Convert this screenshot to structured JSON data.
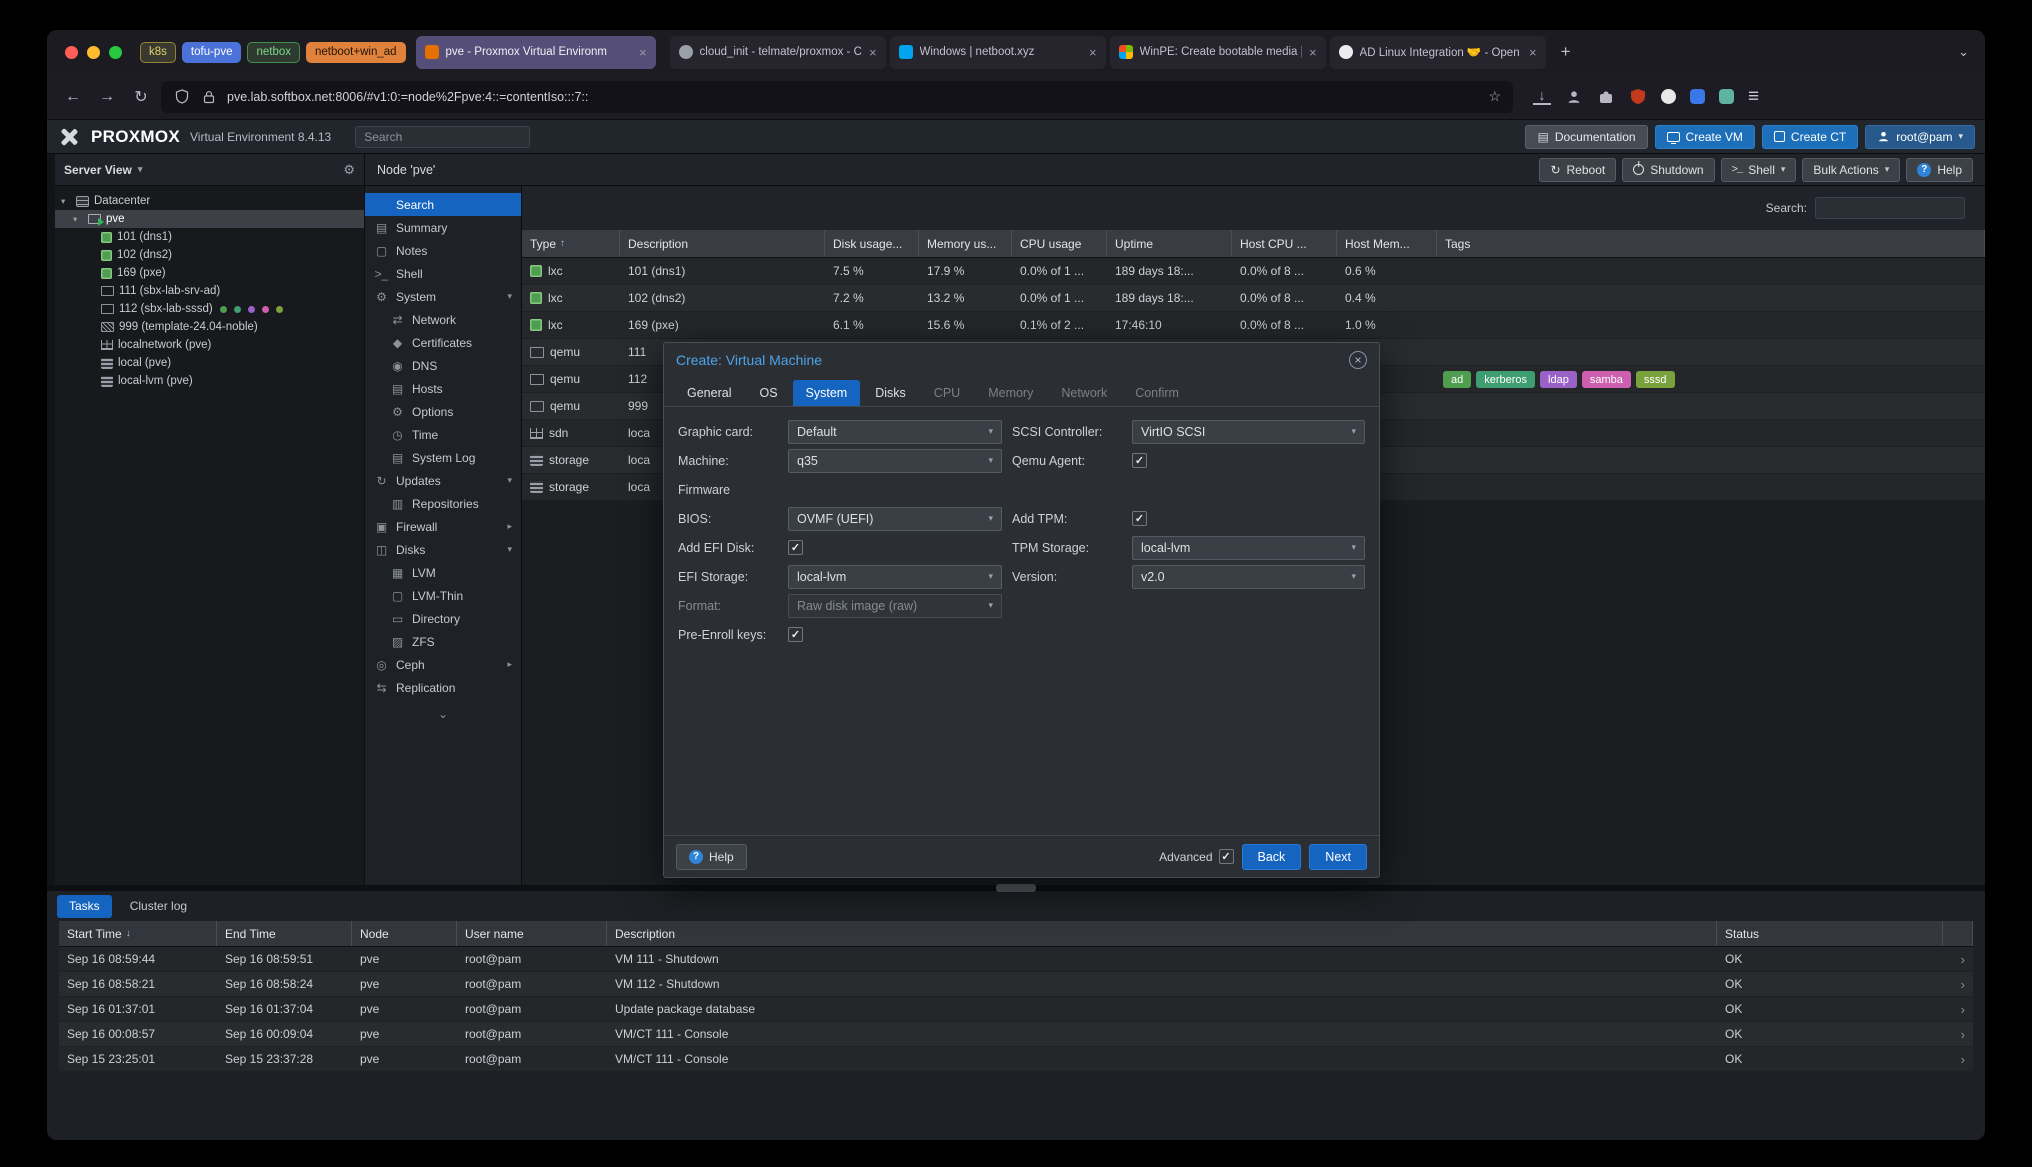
{
  "browser": {
    "tab_groups": [
      {
        "label": "k8s",
        "style": "color:#e0d36a;box-shadow:inset 0 0 0 1px #8f8435;background:#3a3930"
      },
      {
        "label": "tofu-pve",
        "style": "background:#4a72d8;color:#ffffff"
      },
      {
        "label": "netbox",
        "style": "color:#7fd88a;box-shadow:inset 0 0 0 1px #3f8f4a;background:#2e3a30"
      },
      {
        "label": "netboot+win_ad",
        "style": "background:#e0823c;color:#241504"
      }
    ],
    "tabs": [
      {
        "title": "pve - Proxmox Virtual Environm",
        "cls": "active",
        "favicon_style": "background:#e57000"
      },
      {
        "title": "cloud_init - telmate/proxmox - C",
        "favicon_style": "background:#9aa0a8;border-radius:50%"
      },
      {
        "title": "Windows | netboot.xyz",
        "favicon_style": "background:#00a4ef"
      },
      {
        "title": "WinPE: Create bootable media |",
        "favicon_style": "background:conic-gradient(#7fba00 0 25%,#ffb900 0 50%,#00a4ef 0 75%,#f25022 0)"
      },
      {
        "title": "AD Linux Integration 🤝 - Open",
        "favicon_style": "background:#ececf1;border-radius:50%"
      }
    ],
    "new_tab": "+",
    "all_tabs_chevron": "⌄",
    "nav": {
      "back": "←",
      "forward": "→",
      "reload": "↻"
    },
    "url": "pve.lab.softbox.net:8006/#v1:0:=node%2Fpve:4::=contentIso:::7::",
    "star": "☆",
    "menu_icon": "≡"
  },
  "pve_header": {
    "logo_text": "PROXMOX",
    "subtitle": "Virtual Environment 8.4.13",
    "search_placeholder": "Search",
    "documentation": "Documentation",
    "create_vm": "Create VM",
    "create_ct": "Create CT",
    "user_menu": "root@pam"
  },
  "tree": {
    "view_label": "Server View",
    "view_chevron": "▾",
    "gear": "⚙",
    "items": [
      {
        "label": "Datacenter"
      },
      {
        "label": "pve"
      },
      {
        "label": "101 (dns1)"
      },
      {
        "label": "102 (dns2)"
      },
      {
        "label": "169 (pxe)"
      },
      {
        "label": "111 (sbx-lab-srv-ad)"
      },
      {
        "label": "112 (sbx-lab-sssd)"
      },
      {
        "label": "999 (template-24.04-noble)"
      },
      {
        "label": "localnetwork (pve)"
      },
      {
        "label": "local (pve)"
      },
      {
        "label": "local-lvm (pve)"
      }
    ],
    "dot_styles": [
      "background:#4f9e4f",
      "background:#3f9d72",
      "background:#9a62c9",
      "background:#cd5fae",
      "background:#7aa23c"
    ]
  },
  "node_panel": {
    "title": "Node 'pve'",
    "reboot": "Reboot",
    "shutdown": "Shutdown",
    "shell": "Shell",
    "bulk_actions": "Bulk Actions",
    "help": "Help"
  },
  "menu": {
    "items": [
      {
        "label": "Search",
        "cls": "active"
      },
      {
        "label": "Summary",
        "glyph": "▤"
      },
      {
        "label": "Notes",
        "glyph": "▢"
      },
      {
        "label": "Shell",
        "glyph": ">_"
      },
      {
        "label": "System",
        "glyph": "⚙",
        "chevron": "▾"
      },
      {
        "label": "Network",
        "glyph": "⇄",
        "cls": "sub"
      },
      {
        "label": "Certificates",
        "glyph": "◆",
        "cls": "sub"
      },
      {
        "label": "DNS",
        "glyph": "◉",
        "cls": "sub"
      },
      {
        "label": "Hosts",
        "glyph": "▤",
        "cls": "sub"
      },
      {
        "label": "Options",
        "glyph": "⚙",
        "cls": "sub"
      },
      {
        "label": "Time",
        "glyph": "◷",
        "cls": "sub"
      },
      {
        "label": "System Log",
        "glyph": "▤",
        "cls": "sub"
      },
      {
        "label": "Updates",
        "glyph": "↻",
        "chevron": "▾"
      },
      {
        "label": "Repositories",
        "glyph": "▥",
        "cls": "sub"
      },
      {
        "label": "Firewall",
        "glyph": "▣",
        "chevron": "▸"
      },
      {
        "label": "Disks",
        "glyph": "◫",
        "chevron": "▾"
      },
      {
        "label": "LVM",
        "glyph": "▦",
        "cls": "sub"
      },
      {
        "label": "LVM-Thin",
        "glyph": "▢",
        "cls": "sub"
      },
      {
        "label": "Directory",
        "glyph": "▭",
        "cls": "sub"
      },
      {
        "label": "ZFS",
        "glyph": "▨",
        "cls": "sub"
      },
      {
        "label": "Ceph",
        "glyph": "◎",
        "chevron": "▸"
      },
      {
        "label": "Replication",
        "glyph": "⇆"
      }
    ],
    "more": "⌄"
  },
  "guests": {
    "search_label": "Search:",
    "sort_icon": "↑",
    "columns": [
      "Type",
      "Description",
      "Disk usage...",
      "Memory us...",
      "CPU usage",
      "Uptime",
      "Host CPU ...",
      "Host Mem...",
      "Tags"
    ],
    "rows": [
      {
        "type": "lxc",
        "desc": "101 (dns1)",
        "disk": "7.5 %",
        "mem": "17.9 %",
        "cpu": "0.0% of 1 ...",
        "up": "189 days 18:...",
        "hcpu": "0.0% of 8 ...",
        "hmem": "0.6 %"
      },
      {
        "type": "lxc",
        "desc": "102 (dns2)",
        "disk": "7.2 %",
        "mem": "13.2 %",
        "cpu": "0.0% of 1 ...",
        "up": "189 days 18:...",
        "hcpu": "0.0% of 8 ...",
        "hmem": "0.4 %"
      },
      {
        "type": "lxc",
        "desc": "169 (pxe)",
        "disk": "6.1 %",
        "mem": "15.6 %",
        "cpu": "0.1% of 2 ...",
        "up": "17:46:10",
        "hcpu": "0.0% of 8 ...",
        "hmem": "1.0 %"
      },
      {
        "type": "qemu",
        "desc": "111"
      },
      {
        "type": "qemu",
        "desc": "112"
      },
      {
        "type": "qemu",
        "desc": "999"
      },
      {
        "type": "sdn",
        "desc": "loca"
      },
      {
        "type": "storage",
        "desc": "loca"
      },
      {
        "type": "storage",
        "desc": "loca"
      }
    ],
    "tags": [
      {
        "label": "ad",
        "style": "background:#4f9e4f"
      },
      {
        "label": "kerberos",
        "style": "background:#3f9d72"
      },
      {
        "label": "ldap",
        "style": "background:#9a62c9"
      },
      {
        "label": "samba",
        "style": "background:#cd5fae"
      },
      {
        "label": "sssd",
        "style": "background:#7aa23c"
      }
    ]
  },
  "dialog": {
    "title": "Create: Virtual Machine",
    "tabs": [
      {
        "label": "General",
        "cls": "on"
      },
      {
        "label": "OS",
        "cls": "on"
      },
      {
        "label": "System",
        "cls": "active"
      },
      {
        "label": "Disks",
        "cls": "on"
      },
      {
        "label": "CPU",
        "cls": "off"
      },
      {
        "label": "Memory",
        "cls": "off"
      },
      {
        "label": "Network",
        "cls": "off"
      },
      {
        "label": "Confirm",
        "cls": "off"
      }
    ],
    "fields": {
      "graphic_card": {
        "label": "Graphic card:",
        "value": "Default"
      },
      "machine": {
        "label": "Machine:",
        "value": "q35"
      },
      "firmware_section": "Firmware",
      "bios": {
        "label": "BIOS:",
        "value": "OVMF (UEFI)"
      },
      "add_efi_disk": {
        "label": "Add EFI Disk:",
        "checked": true
      },
      "efi_storage": {
        "label": "EFI Storage:",
        "value": "local-lvm"
      },
      "format": {
        "label": "Format:",
        "value": "Raw disk image (raw)",
        "disabled": true
      },
      "pre_enroll": {
        "label": "Pre-Enroll keys:",
        "checked": true
      },
      "scsi": {
        "label": "SCSI Controller:",
        "value": "VirtIO SCSI"
      },
      "qemu_agent": {
        "label": "Qemu Agent:",
        "checked": true
      },
      "add_tpm": {
        "label": "Add TPM:",
        "checked": true
      },
      "tpm_storage": {
        "label": "TPM Storage:",
        "value": "local-lvm"
      },
      "version": {
        "label": "Version:",
        "value": "v2.0"
      }
    },
    "footer": {
      "help": "Help",
      "advanced": "Advanced",
      "advanced_checked": true,
      "back": "Back",
      "next": "Next"
    }
  },
  "tasks": {
    "tabs": [
      "Tasks",
      "Cluster log"
    ],
    "sort_icon": "↓",
    "columns": [
      "Start Time",
      "End Time",
      "Node",
      "User name",
      "Description",
      "Status"
    ],
    "row_chevron": "›",
    "rows": [
      {
        "start": "Sep 16 08:59:44",
        "end": "Sep 16 08:59:51",
        "node": "pve",
        "user": "root@pam",
        "desc": "VM 111 - Shutdown",
        "status": "OK"
      },
      {
        "start": "Sep 16 08:58:21",
        "end": "Sep 16 08:58:24",
        "node": "pve",
        "user": "root@pam",
        "desc": "VM 112 - Shutdown",
        "status": "OK"
      },
      {
        "start": "Sep 16 01:37:01",
        "end": "Sep 16 01:37:04",
        "node": "pve",
        "user": "root@pam",
        "desc": "Update package database",
        "status": "OK"
      },
      {
        "start": "Sep 16 00:08:57",
        "end": "Sep 16 00:09:04",
        "node": "pve",
        "user": "root@pam",
        "desc": "VM/CT 111 - Console",
        "status": "OK"
      },
      {
        "start": "Sep 15 23:25:01",
        "end": "Sep 15 23:37:28",
        "node": "pve",
        "user": "root@pam",
        "desc": "VM/CT 111 - Console",
        "status": "OK"
      }
    ]
  },
  "colors": {
    "accent_blue": "#1565c0",
    "proxmox_orange": "#e57000",
    "active_tab_purple": "#554e78",
    "tag_ad": "#4f9e4f",
    "tag_kerberos": "#3f9d72",
    "tag_ldap": "#9a62c9",
    "tag_samba": "#cd5fae",
    "tag_sssd": "#7aa23c"
  }
}
